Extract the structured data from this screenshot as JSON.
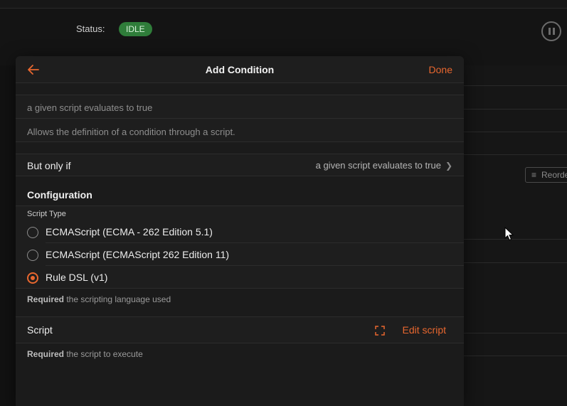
{
  "background": {
    "status_label": "Status:",
    "status_badge": "IDLE",
    "reorder_label": "Reorder"
  },
  "dialog": {
    "title": "Add Condition",
    "done_label": "Done",
    "condition_name": "a given script evaluates to true",
    "condition_description": "Allows the definition of a condition through a script.",
    "but_only_if": {
      "label": "But only if",
      "value": "a given script evaluates to true"
    },
    "configuration": {
      "title": "Configuration",
      "script_type": {
        "label": "Script Type",
        "options": [
          {
            "label": "ECMAScript (ECMA - 262 Edition 5.1)",
            "selected": false
          },
          {
            "label": "ECMAScript (ECMAScript 262 Edition 11)",
            "selected": false
          },
          {
            "label": "Rule DSL (v1)",
            "selected": true
          }
        ],
        "hint_required": "Required",
        "hint_text": " the scripting language used"
      },
      "script": {
        "label": "Script",
        "edit_label": "Edit script",
        "hint_required": "Required",
        "hint_text": " the script to execute"
      }
    }
  },
  "colors": {
    "accent": "#e8672f",
    "status_idle": "#2f7d3a"
  },
  "icons": {
    "back": "arrow-left-icon",
    "chevron": "chevron-right-icon",
    "expand": "fullscreen-icon",
    "pause": "pause-icon"
  }
}
